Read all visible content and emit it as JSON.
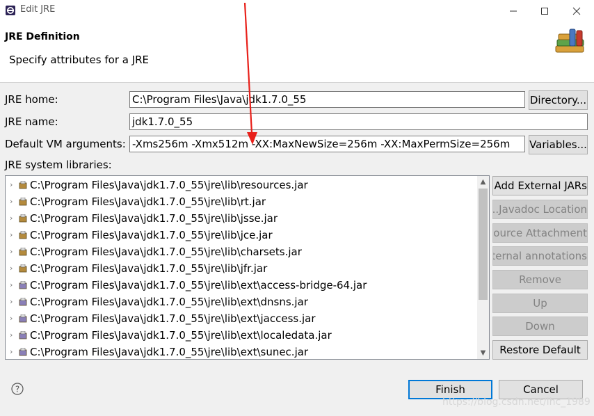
{
  "window": {
    "title": "Edit JRE",
    "controls": {
      "minimize": "minimize-icon",
      "maximize": "maximize-icon",
      "close": "close-icon"
    }
  },
  "header": {
    "section_title": "JRE Definition",
    "description": "Specify attributes for a JRE"
  },
  "form": {
    "jre_home_label": "JRE home:",
    "jre_home_value": "C:\\Program Files\\Java\\jdk1.7.0_55",
    "directory_button": "Directory...",
    "jre_name_label": "JRE name:",
    "jre_name_value": "jdk1.7.0_55",
    "vm_args_label": "Default VM arguments:",
    "vm_args_value": "-Xms256m -Xmx512m -XX:MaxNewSize=256m -XX:MaxPermSize=256m",
    "variables_button": "Variables...",
    "system_libraries_label": "JRE system libraries:"
  },
  "libraries": [
    {
      "path": "C:\\Program Files\\Java\\jdk1.7.0_55\\jre\\lib\\resources.jar",
      "icon": "jar-icon"
    },
    {
      "path": "C:\\Program Files\\Java\\jdk1.7.0_55\\jre\\lib\\rt.jar",
      "icon": "jar-icon"
    },
    {
      "path": "C:\\Program Files\\Java\\jdk1.7.0_55\\jre\\lib\\jsse.jar",
      "icon": "jar-icon"
    },
    {
      "path": "C:\\Program Files\\Java\\jdk1.7.0_55\\jre\\lib\\jce.jar",
      "icon": "jar-icon"
    },
    {
      "path": "C:\\Program Files\\Java\\jdk1.7.0_55\\jre\\lib\\charsets.jar",
      "icon": "jar-icon"
    },
    {
      "path": "C:\\Program Files\\Java\\jdk1.7.0_55\\jre\\lib\\jfr.jar",
      "icon": "jar-icon"
    },
    {
      "path": "C:\\Program Files\\Java\\jdk1.7.0_55\\jre\\lib\\ext\\access-bridge-64.jar",
      "icon": "ext-jar-icon"
    },
    {
      "path": "C:\\Program Files\\Java\\jdk1.7.0_55\\jre\\lib\\ext\\dnsns.jar",
      "icon": "ext-jar-icon"
    },
    {
      "path": "C:\\Program Files\\Java\\jdk1.7.0_55\\jre\\lib\\ext\\jaccess.jar",
      "icon": "ext-jar-icon"
    },
    {
      "path": "C:\\Program Files\\Java\\jdk1.7.0_55\\jre\\lib\\ext\\localedata.jar",
      "icon": "ext-jar-icon"
    },
    {
      "path": "C:\\Program Files\\Java\\jdk1.7.0_55\\jre\\lib\\ext\\sunec.jar",
      "icon": "ext-jar-icon"
    }
  ],
  "side_buttons": {
    "add_external_jars": "Add External JARs...",
    "javadoc_location": "Javadoc Location...",
    "source_attachment": "Source Attachment...",
    "external_annotations": "External annotations...",
    "remove": "Remove",
    "up": "Up",
    "down": "Down",
    "restore_default": "Restore Default"
  },
  "footer": {
    "finish_button": "Finish",
    "cancel_button": "Cancel",
    "help_icon": "help-icon"
  },
  "watermark": "https://blog.csdn.net/lhc_1989",
  "colors": {
    "accent": "#0078d7",
    "annotation_arrow": "#e8201a",
    "dialog_background": "#f0f0f0"
  }
}
